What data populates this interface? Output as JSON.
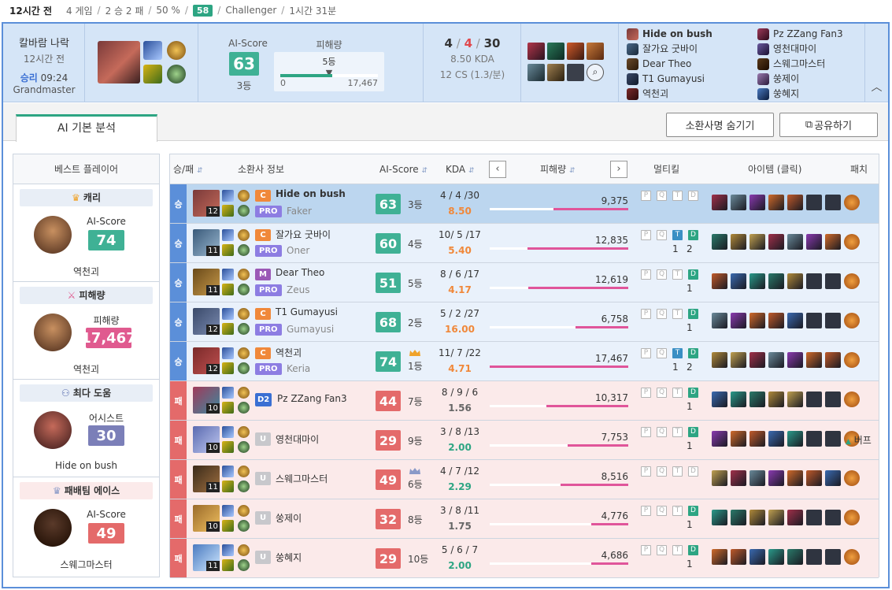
{
  "topbar": {
    "time": "12시간 전",
    "games": "4 게임",
    "record": "2 승 2 패",
    "winrate": "50 %",
    "lp": "58",
    "tier": "Challenger",
    "duration": "1시간 31분"
  },
  "summary": {
    "mode": "칼바람 나락",
    "ago": "12시간 전",
    "result": "승리",
    "length": "09:24",
    "tier": "Grandmaster",
    "ai_label": "AI-Score",
    "ai_value": "63",
    "ai_rank": "3등",
    "dmg_label": "피해량",
    "dmg_rank": "5등",
    "dmg_min": "0",
    "dmg_max": "17,467",
    "dmg_fraction": 0.53,
    "kills": "4",
    "deaths": "4",
    "assists": "30",
    "kda_ratio": "8.50 KDA",
    "cs": "12 CS (1.3/분)",
    "team_blue": [
      "Hide on bush",
      "잘가요 굿바이",
      "Dear Theo",
      "T1 Gumayusi",
      "역천괴"
    ],
    "team_red": [
      "Pz ZZang Fan3",
      "영천대마이",
      "스웨그마스터",
      "쑹제이",
      "쑹혜지"
    ],
    "collapse_icon": "chevron-up"
  },
  "tabs": {
    "active": "AI 기본 분석",
    "hide_btn": "소환사명 숨기기",
    "share_btn": "공유하기"
  },
  "sidebar": {
    "title": "베스트 플레이어",
    "cards": [
      {
        "title": "캐리",
        "icon": "crown",
        "stat_label": "AI-Score",
        "stat_value": "74",
        "color": "#3fb195",
        "name": "역천괴"
      },
      {
        "title": "피해량",
        "icon": "sword",
        "stat_label": "피해량",
        "stat_value": "17,467",
        "color": "#e05a8f",
        "name": "역천괴"
      },
      {
        "title": "최다 도움",
        "icon": "helping",
        "stat_label": "어시스트",
        "stat_value": "30",
        "color": "#7b7fb8",
        "name": "Hide on bush"
      },
      {
        "title": "패배팀 에이스",
        "icon": "crown",
        "stat_label": "AI-Score",
        "stat_value": "49",
        "color": "#e46a6a",
        "name": "스웨그마스터"
      }
    ]
  },
  "table": {
    "headers": {
      "result": "승/패",
      "summoner": "소환사 정보",
      "ai": "AI-Score",
      "kda": "KDA",
      "dmg": "피해량",
      "multi": "멀티킬",
      "items": "아이템 (클릭)",
      "patch": "패치"
    },
    "rows": [
      {
        "res": "승",
        "level": "12",
        "pos": "C",
        "pos_color": "#f0883a",
        "name": "Hide on bush",
        "team": "PRO",
        "pro": "Faker",
        "score": "63",
        "rank": "3등",
        "kda": "4 / 4 /30",
        "ratio": "8.50",
        "ratio_color": "#f0883a",
        "dmg": "9,375",
        "dmg_frac": 0.54,
        "mk": [
          false,
          false,
          false,
          false
        ],
        "mk_nums": [
          "",
          ""
        ],
        "patch": ""
      },
      {
        "res": "승",
        "level": "11",
        "pos": "C",
        "pos_color": "#f0883a",
        "name": "잘가요 굿바이",
        "team": "PRO",
        "pro": "Oner",
        "score": "60",
        "rank": "4등",
        "kda": "10/ 5 /17",
        "ratio": "5.40",
        "ratio_color": "#f0883a",
        "dmg": "12,835",
        "dmg_frac": 0.73,
        "mk": [
          false,
          false,
          true,
          true
        ],
        "mk_nums": [
          "1",
          "2"
        ],
        "patch": ""
      },
      {
        "res": "승",
        "level": "11",
        "pos": "M",
        "pos_color": "#9b59b6",
        "name": "Dear Theo",
        "team": "PRO",
        "pro": "Zeus",
        "score": "51",
        "rank": "5등",
        "kda": "8 / 6 /17",
        "ratio": "4.17",
        "ratio_color": "#f0883a",
        "dmg": "12,619",
        "dmg_frac": 0.72,
        "mk": [
          false,
          false,
          false,
          true
        ],
        "mk_nums": [
          "",
          "1"
        ],
        "patch": ""
      },
      {
        "res": "승",
        "level": "12",
        "pos": "C",
        "pos_color": "#f0883a",
        "name": "T1 Gumayusi",
        "team": "PRO",
        "pro": "Gumayusi",
        "score": "68",
        "rank": "2등",
        "kda": "5 / 2 /27",
        "ratio": "16.00",
        "ratio_color": "#f0883a",
        "dmg": "6,758",
        "dmg_frac": 0.38,
        "mk": [
          false,
          false,
          false,
          true
        ],
        "mk_nums": [
          "",
          "1"
        ],
        "patch": ""
      },
      {
        "res": "승",
        "level": "12",
        "pos": "C",
        "pos_color": "#f0883a",
        "name": "역천괴",
        "team": "PRO",
        "pro": "Keria",
        "score": "74",
        "rank": "1등",
        "kda": "11/ 7 /22",
        "ratio": "4.71",
        "ratio_color": "#f0883a",
        "dmg": "17,467",
        "dmg_frac": 1.0,
        "mk": [
          false,
          false,
          true,
          true
        ],
        "mk_nums": [
          "1",
          "2"
        ],
        "patch": "",
        "crown": "gold"
      },
      {
        "res": "패",
        "level": "10",
        "tier": "D2",
        "tier_color": "#3a6fd3",
        "name": "Pz ZZang Fan3",
        "score": "44",
        "rank": "7등",
        "kda": "8 / 9 / 6",
        "ratio": "1.56",
        "ratio_color": "#666",
        "dmg": "10,317",
        "dmg_frac": 0.59,
        "mk": [
          false,
          false,
          false,
          true
        ],
        "mk_nums": [
          "",
          "1"
        ],
        "patch": ""
      },
      {
        "res": "패",
        "level": "10",
        "tier": "U",
        "tier_color": "#c8c8cc",
        "name": "영천대마이",
        "score": "29",
        "rank": "9등",
        "kda": "3 / 8 /13",
        "ratio": "2.00",
        "ratio_color": "#2da583",
        "dmg": "7,753",
        "dmg_frac": 0.44,
        "mk": [
          false,
          false,
          false,
          true
        ],
        "mk_nums": [
          "",
          "1"
        ],
        "patch": "버프"
      },
      {
        "res": "패",
        "level": "11",
        "tier": "U",
        "tier_color": "#c8c8cc",
        "name": "스웨그마스터",
        "score": "49",
        "rank": "6등",
        "kda": "4 / 7 /12",
        "ratio": "2.29",
        "ratio_color": "#2da583",
        "dmg": "8,516",
        "dmg_frac": 0.49,
        "mk": [
          false,
          false,
          false,
          false
        ],
        "mk_nums": [
          "",
          ""
        ],
        "patch": "",
        "crown": "silver"
      },
      {
        "res": "패",
        "level": "10",
        "tier": "U",
        "tier_color": "#c8c8cc",
        "name": "쑹제이",
        "score": "32",
        "rank": "8등",
        "kda": "3 / 8 /11",
        "ratio": "1.75",
        "ratio_color": "#666",
        "dmg": "4,776",
        "dmg_frac": 0.27,
        "mk": [
          false,
          false,
          false,
          true
        ],
        "mk_nums": [
          "",
          "1"
        ],
        "patch": ""
      },
      {
        "res": "패",
        "level": "11",
        "tier": "U",
        "tier_color": "#c8c8cc",
        "name": "쑹혜지",
        "score": "29",
        "rank": "10등",
        "kda": "5 / 6 / 7",
        "ratio": "2.00",
        "ratio_color": "#2da583",
        "dmg": "4,686",
        "dmg_frac": 0.27,
        "mk": [
          false,
          false,
          false,
          true
        ],
        "mk_nums": [
          "",
          "1"
        ],
        "patch": ""
      }
    ]
  },
  "colors": {
    "win": "#5b8fd9",
    "loss": "#e46a6a",
    "score_win": "#3fb195",
    "score_loss": "#e46a6a",
    "dmg": "#e0559a"
  }
}
